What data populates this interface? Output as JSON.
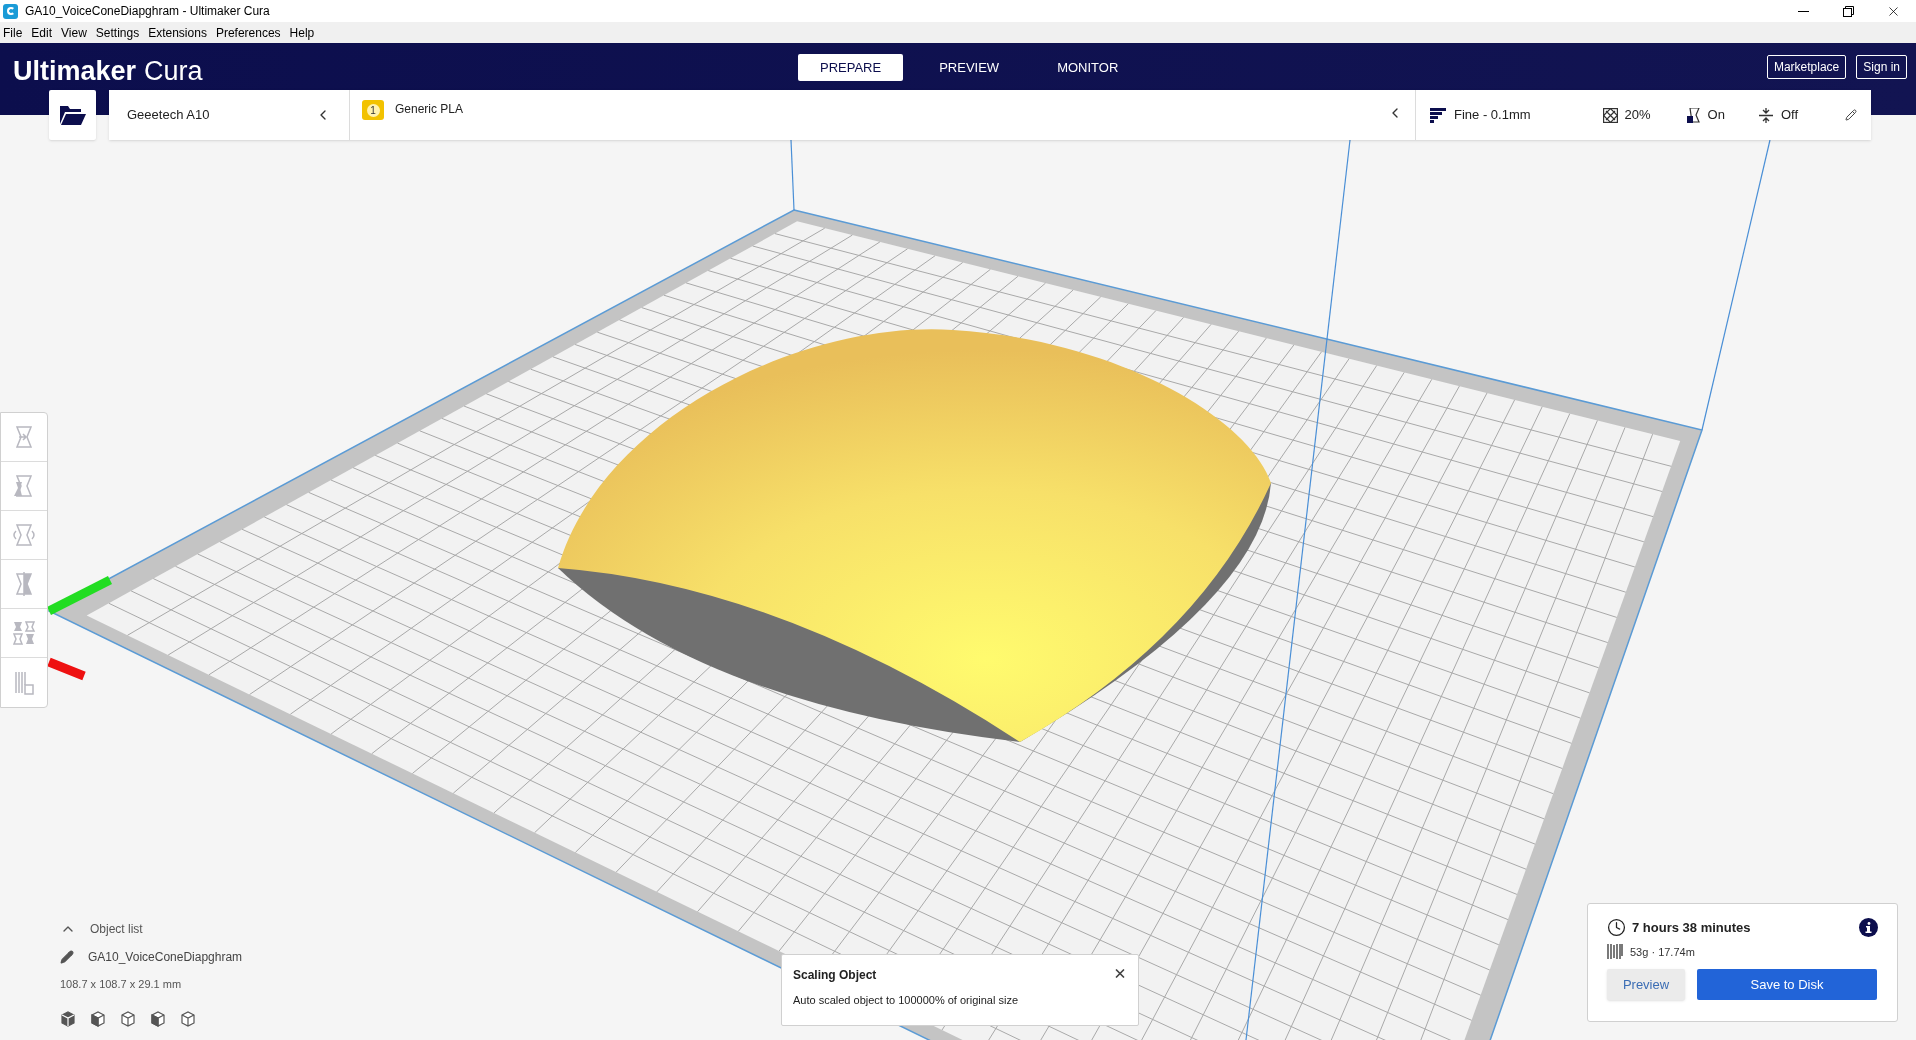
{
  "window": {
    "title": "GA10_VoiceConeDiapghram - Ultimaker Cura"
  },
  "menu": [
    "File",
    "Edit",
    "View",
    "Settings",
    "Extensions",
    "Preferences",
    "Help"
  ],
  "header": {
    "logo": {
      "brand": "Ultimaker",
      "product": "Cura"
    },
    "tabs": [
      {
        "label": "PREPARE",
        "selected": true
      },
      {
        "label": "PREVIEW",
        "selected": false
      },
      {
        "label": "MONITOR",
        "selected": false
      }
    ],
    "buttons": [
      "Marketplace",
      "Sign in"
    ]
  },
  "toolbar": {
    "printer": "Geeetech A10",
    "material": {
      "badge": "1",
      "name": "Generic PLA"
    },
    "print_settings": {
      "profile": "Fine - 0.1mm",
      "infill": "20%",
      "support": "On",
      "adhesion": "Off"
    }
  },
  "object_list": {
    "label": "Object list",
    "expanded": true,
    "object_name": "GA10_VoiceConeDiapghram",
    "dimensions": "108.7 x 108.7 x 29.1 mm"
  },
  "toast": {
    "title": "Scaling Object",
    "message": "Auto scaled object to 100000% of original size"
  },
  "print_info": {
    "time": "7 hours 38 minutes",
    "usage": "53g · 17.74m",
    "buttons": [
      "Preview",
      "Save to Disk"
    ]
  }
}
